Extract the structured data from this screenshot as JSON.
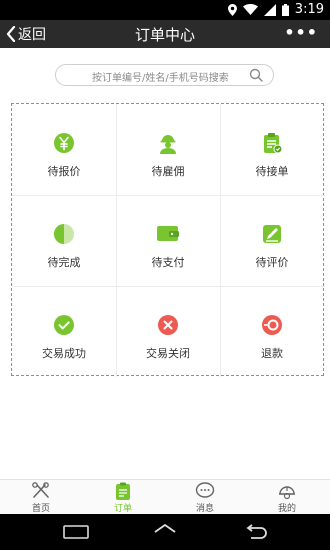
{
  "status_bar": {
    "time": "3:19",
    "icons": [
      "location-icon",
      "wifi-icon",
      "signal-icon",
      "battery-icon"
    ]
  },
  "app_bar": {
    "back_label": "返回",
    "title": "订单中心",
    "more_label": "•••"
  },
  "search": {
    "placeholder": "按订单编号/姓名/手机号码搜索"
  },
  "grid": {
    "items": [
      {
        "label": "待报价",
        "icon": "yen-coin-icon"
      },
      {
        "label": "待雇佣",
        "icon": "worker-icon"
      },
      {
        "label": "待接单",
        "icon": "clipboard-icon"
      },
      {
        "label": "待完成",
        "icon": "pie-progress-icon"
      },
      {
        "label": "待支付",
        "icon": "wallet-icon"
      },
      {
        "label": "待评价",
        "icon": "edit-icon"
      },
      {
        "label": "交易成功",
        "icon": "check-circle-icon"
      },
      {
        "label": "交易关闭",
        "icon": "close-circle-icon"
      },
      {
        "label": "退款",
        "icon": "refund-icon"
      }
    ]
  },
  "bottom_nav": {
    "tabs": [
      {
        "label": "首页",
        "icon": "tools-icon"
      },
      {
        "label": "订单",
        "icon": "order-icon"
      },
      {
        "label": "消息",
        "icon": "chat-icon"
      },
      {
        "label": "我的",
        "icon": "helmet-icon"
      }
    ],
    "active_index": 1
  },
  "colors": {
    "green": "#78c52f",
    "red": "#ee5a52",
    "dashed_border": "#e36b6b"
  }
}
